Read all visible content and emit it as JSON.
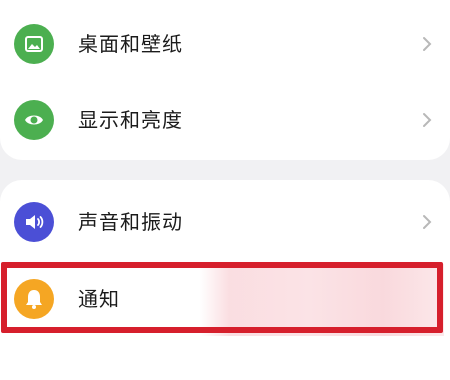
{
  "settings": {
    "items": [
      {
        "label": "桌面和壁纸",
        "icon": "wallpaper-icon",
        "icon_color": "#4caf50"
      },
      {
        "label": "显示和亮度",
        "icon": "eye-icon",
        "icon_color": "#4caf50"
      },
      {
        "label": "声音和振动",
        "icon": "speaker-icon",
        "icon_color": "#4b4fd6"
      },
      {
        "label": "通知",
        "icon": "bell-icon",
        "icon_color": "#f5a623"
      }
    ],
    "highlight_color": "#d61f2c"
  }
}
